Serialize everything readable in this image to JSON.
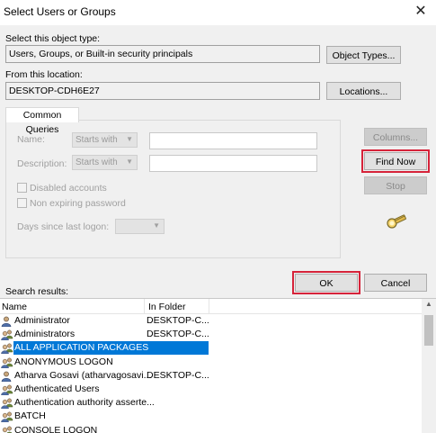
{
  "window": {
    "title": "Select Users or Groups"
  },
  "object_type": {
    "label": "Select this object type:",
    "value": "Users, Groups, or Built-in security principals",
    "button": "Object Types..."
  },
  "location": {
    "label": "From this location:",
    "value": "DESKTOP-CDH6E27",
    "button": "Locations..."
  },
  "common_queries": {
    "tab": "Common Queries",
    "name_label": "Name:",
    "name_combo": "Starts with",
    "description_label": "Description:",
    "description_combo": "Starts with",
    "disabled_accounts": "Disabled accounts",
    "non_expiring": "Non expiring password",
    "days_label": "Days since last logon:"
  },
  "buttons": {
    "columns": "Columns...",
    "find_now": "Find Now",
    "stop": "Stop",
    "ok": "OK",
    "cancel": "Cancel"
  },
  "results": {
    "label": "Search results:",
    "columns": [
      "Name",
      "In Folder"
    ],
    "rows": [
      {
        "name": "Administrator",
        "folder": "DESKTOP-C...",
        "icon": "user-icon"
      },
      {
        "name": "Administrators",
        "folder": "DESKTOP-C...",
        "icon": "group-icon"
      },
      {
        "name": "ALL APPLICATION PACKAGES",
        "folder": "",
        "icon": "group-icon",
        "selected": true
      },
      {
        "name": "ANONYMOUS LOGON",
        "folder": "",
        "icon": "group-icon"
      },
      {
        "name": "Atharva Gosavi (atharvagosavi...",
        "folder": "DESKTOP-C...",
        "icon": "user-icon"
      },
      {
        "name": "Authenticated Users",
        "folder": "",
        "icon": "group-icon"
      },
      {
        "name": "Authentication authority asserte...",
        "folder": "",
        "icon": "group-icon"
      },
      {
        "name": "BATCH",
        "folder": "",
        "icon": "group-icon"
      },
      {
        "name": "CONSOLE LOGON",
        "folder": "",
        "icon": "group-icon"
      }
    ]
  },
  "colors": {
    "highlight": "#d6233a",
    "selection": "#0078d7"
  }
}
